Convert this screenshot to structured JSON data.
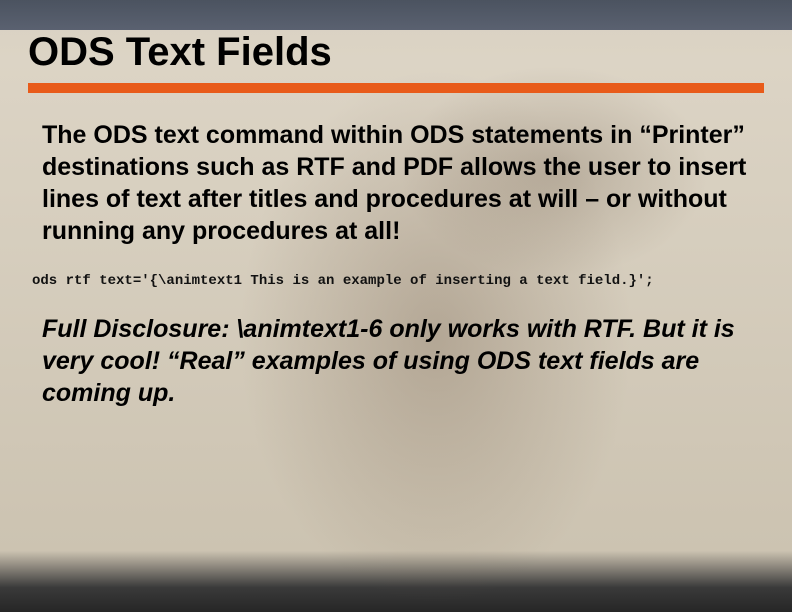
{
  "slide": {
    "title": "ODS Text Fields",
    "paragraph": "The ODS text command within ODS statements in “Printer” destinations such as RTF and PDF allows the user to insert lines of text after titles and procedures at will – or without running any procedures at all!",
    "code": "ods rtf text='{\\animtext1 This is an example of inserting a text field.}';",
    "disclosure": "Full Disclosure:  \\animtext1-6 only works with RTF.  But it is very cool!  “Real” examples of using ODS text fields are coming up."
  },
  "colors": {
    "accent": "#e85b1a"
  }
}
